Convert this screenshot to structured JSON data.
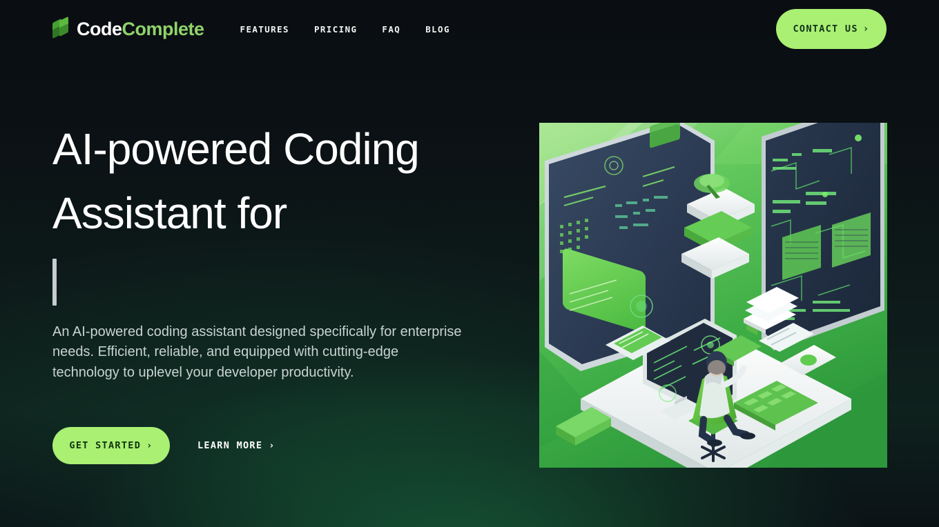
{
  "brand": {
    "name_part_one": "Code",
    "name_part_two": "Complete",
    "logo_icon": "green-blocks-icon"
  },
  "nav": {
    "items": [
      {
        "label": "FEATURES"
      },
      {
        "label": "PRICING"
      },
      {
        "label": "FAQ"
      },
      {
        "label": "BLOG"
      }
    ],
    "contact": {
      "label": "CONTACT US",
      "chevron": "›"
    }
  },
  "hero": {
    "headline": "AI-powered Coding Assistant for",
    "typing_cursor": "|",
    "subcopy": "An AI-powered coding assistant designed specifically for enterprise needs. Efficient, reliable, and equipped with cutting-edge technology to uplevel your developer productivity.",
    "primary_cta": {
      "label": "GET STARTED",
      "chevron": "›"
    },
    "secondary_cta": {
      "label": "LEARN MORE",
      "chevron": "›"
    },
    "illustration_alt": "isometric-developer-workspace-illustration"
  },
  "colors": {
    "accent_green": "#a9f073",
    "logo_green": "#8fd36a",
    "background_dark": "#0b1014",
    "background_glow": "#1e8c4b",
    "illustration_green": "#5cc45a",
    "screen_navy": "#2c3a52",
    "text_primary": "#ffffff",
    "text_secondary": "#c9d3d0"
  }
}
